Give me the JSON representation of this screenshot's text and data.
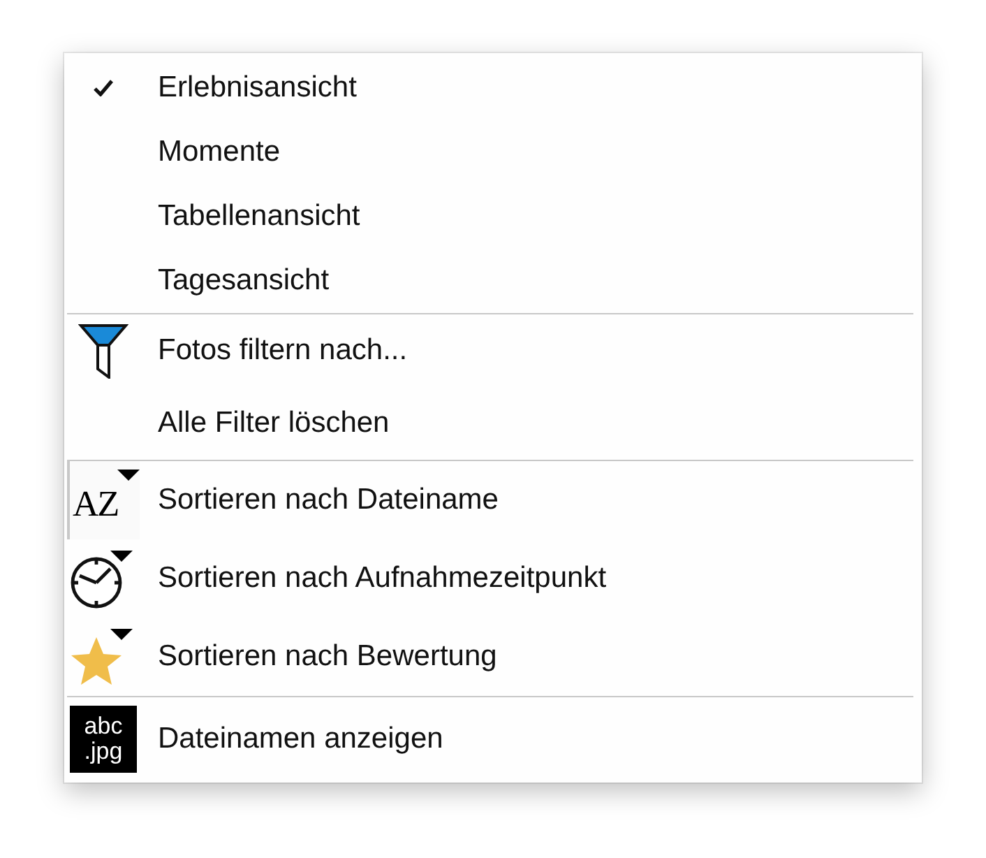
{
  "groups": [
    {
      "kind": "views",
      "items": [
        {
          "label": "Erlebnisansicht",
          "checked": true
        },
        {
          "label": "Momente",
          "checked": false
        },
        {
          "label": "Tabellenansicht",
          "checked": false
        },
        {
          "label": "Tagesansicht",
          "checked": false
        }
      ]
    },
    {
      "kind": "filter",
      "items": [
        {
          "label": "Fotos filtern nach..."
        },
        {
          "label": "Alle Filter löschen"
        }
      ]
    },
    {
      "kind": "sort",
      "items": [
        {
          "label": "Sortieren nach Dateiname",
          "icon_text": "AZ",
          "selected": true
        },
        {
          "label": "Sortieren nach Aufnahmezeitpunkt",
          "selected": false
        },
        {
          "label": "Sortieren nach Bewertung",
          "selected": false
        }
      ]
    },
    {
      "kind": "names",
      "items": [
        {
          "label": "Dateinamen anzeigen",
          "icon_text": [
            "abc",
            ".jpg"
          ]
        }
      ]
    }
  ]
}
